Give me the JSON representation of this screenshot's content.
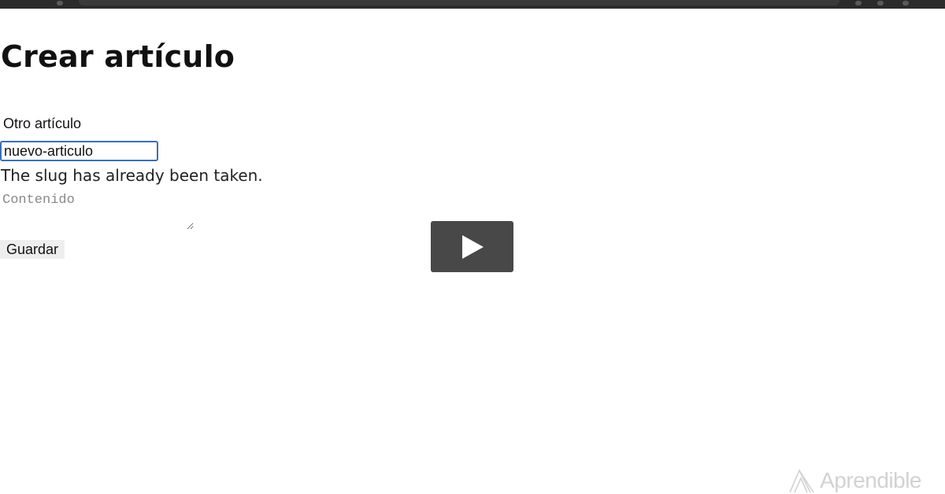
{
  "form": {
    "heading": "Crear artículo",
    "title_value": "Otro artículo",
    "slug_value": "nuevo-articulo",
    "slug_error": "The slug has already been taken.",
    "content_placeholder": "Contenido",
    "save_label": "Guardar"
  },
  "video": {
    "play_icon": "play-icon"
  },
  "branding": {
    "logo_icon": "aprendible-logo-icon",
    "name": "Aprendible"
  },
  "colors": {
    "input_focus_border": "#3b6fb6",
    "play_button_bg": "#2b2b2b",
    "brand_text": "#d2d2d2"
  }
}
